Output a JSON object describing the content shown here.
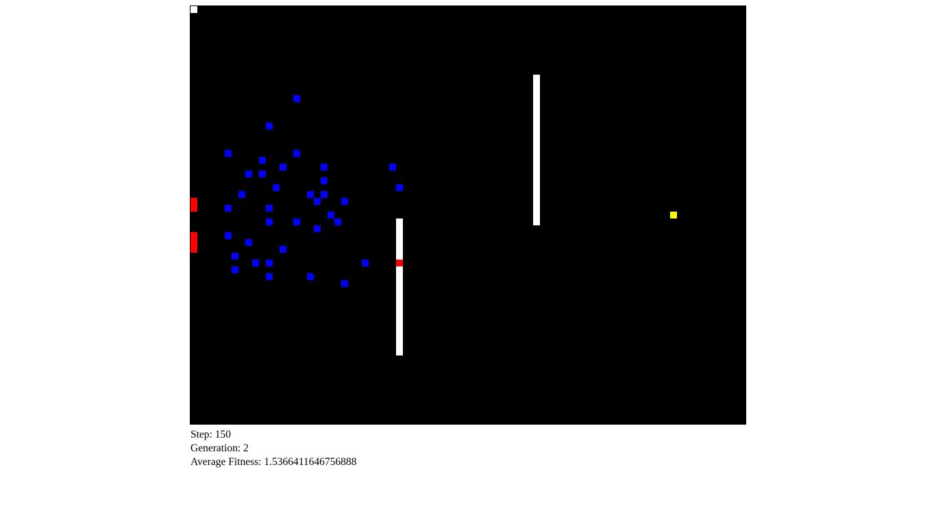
{
  "colors": {
    "background": "#000000",
    "agent": "#0000ff",
    "wall": "#ffffff",
    "hazard": "#ff0000",
    "goal": "#ffff00",
    "spawn": "#ffffff"
  },
  "stats": {
    "step_label": "Step:",
    "step_value": "150",
    "generation_label": "Generation:",
    "generation_value": "2",
    "fitness_label": "Average Fitness:",
    "fitness_value": "1.5366411646756888"
  }
}
